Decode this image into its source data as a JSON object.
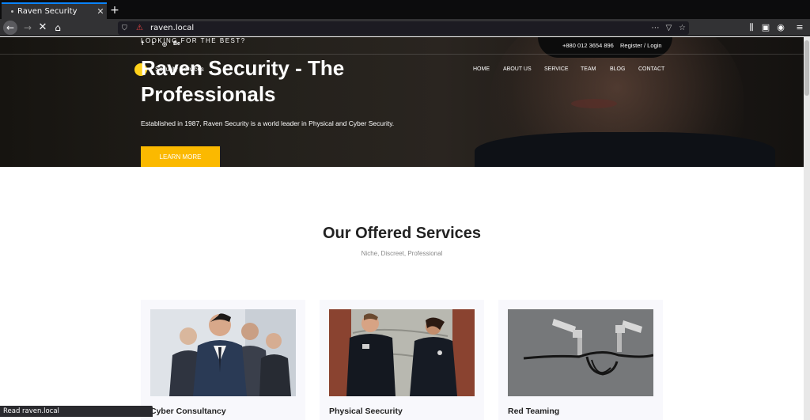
{
  "browser": {
    "tab_title": "Raven Security",
    "tab_close": "✕",
    "new_tab": "+",
    "url": "raven.local",
    "status_text": "Read raven.local"
  },
  "header": {
    "tagline": "LOOKING FOR THE BEST?",
    "social": [
      "f",
      "t",
      "◎",
      "Be"
    ],
    "phone": "+880 012 3654 896",
    "auth_link": "Register / Login",
    "logo_text": "Security Services",
    "menu": [
      "HOME",
      "ABOUT US",
      "SERVICE",
      "TEAM",
      "BLOG",
      "CONTACT"
    ]
  },
  "hero": {
    "title": "Raven Security - The Professionals",
    "subtitle": "Established in 1987, Raven Security is a world leader in Physical and Cyber Security.",
    "button": "LEARN MORE"
  },
  "services": {
    "title": "Our Offered Services",
    "subtitle": "Niche, Discreet, Professional",
    "cards": [
      {
        "caption": "Cyber Consultancy"
      },
      {
        "caption": "Physical Seecurity"
      },
      {
        "caption": "Red Teaming"
      }
    ]
  },
  "colors": {
    "accent": "#fbb900",
    "tab_highlight": "#0a84ff",
    "logo": "#ffd11a"
  }
}
